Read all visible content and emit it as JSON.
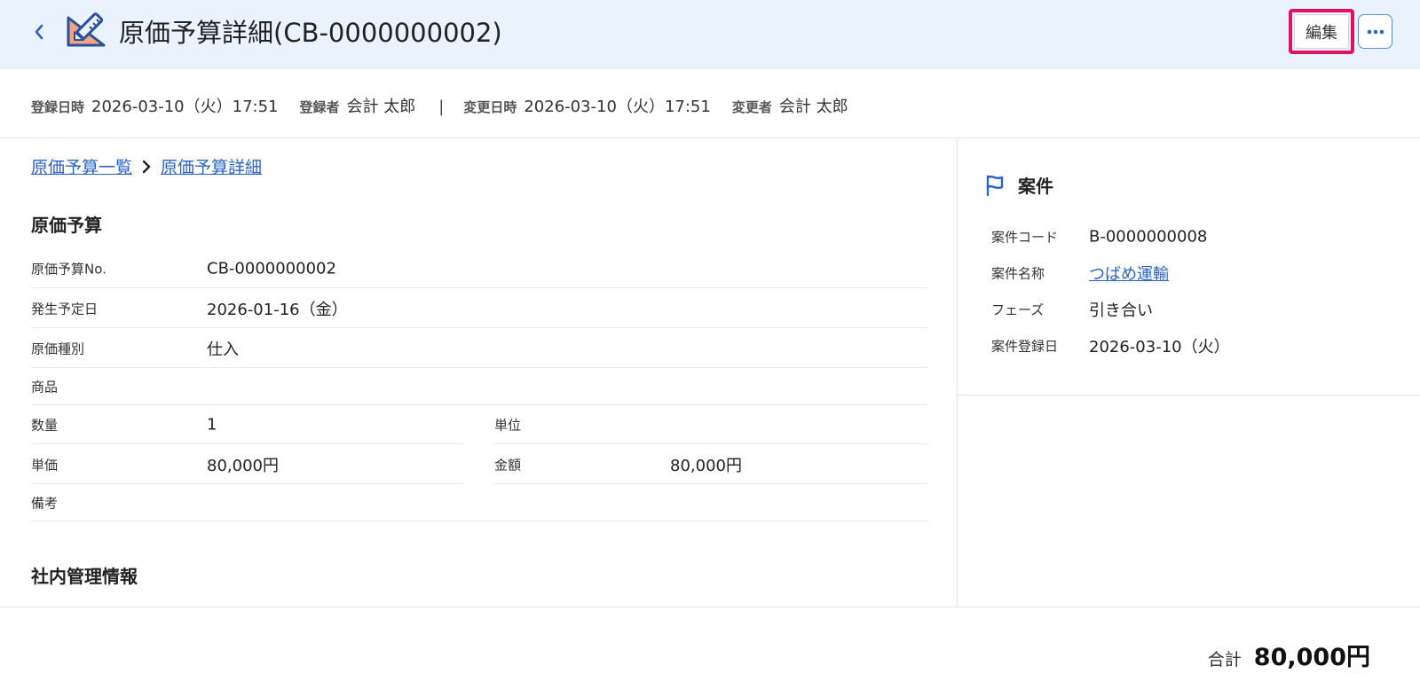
{
  "header": {
    "title": "原価予算詳細(CB-0000000002)",
    "edit_label": "編集",
    "icon": "ruler-pencil-icon",
    "accent_color": "#2a63c9",
    "highlight_color": "#e0115f"
  },
  "meta": {
    "created_at_label": "登録日時",
    "created_at": "2026-03-10（火）17:51",
    "creator_label": "登録者",
    "creator": "会計 太郎",
    "separator": "|",
    "updated_at_label": "変更日時",
    "updated_at": "2026-03-10（火）17:51",
    "updater_label": "変更者",
    "updater": "会計 太郎"
  },
  "breadcrumb": {
    "items": [
      "原価予算一覧",
      "原価予算詳細"
    ]
  },
  "budget": {
    "section_title": "原価予算",
    "fields": [
      {
        "label": "原価予算No.",
        "value": "CB-0000000002"
      },
      {
        "label": "発生予定日",
        "value": "2026-01-16（金）"
      },
      {
        "label": "原価種別",
        "value": "仕入"
      },
      {
        "label": "商品",
        "value": ""
      },
      {
        "label": "数量",
        "value": "1"
      },
      {
        "label": "単位",
        "value": ""
      },
      {
        "label": "単価",
        "value": "80,000円"
      },
      {
        "label": "金額",
        "value": "80,000円"
      },
      {
        "label": "備考",
        "value": ""
      }
    ]
  },
  "internal": {
    "section_title": "社内管理情報"
  },
  "project": {
    "title": "案件",
    "fields": [
      {
        "label": "案件コード",
        "value": "B-0000000008"
      },
      {
        "label": "案件名称",
        "value": "つばめ運輸"
      },
      {
        "label": "フェーズ",
        "value": "引き合い"
      },
      {
        "label": "案件登録日",
        "value": "2026-03-10（火）"
      }
    ]
  },
  "footer": {
    "total_label": "合計",
    "total_value": "80,000円"
  }
}
